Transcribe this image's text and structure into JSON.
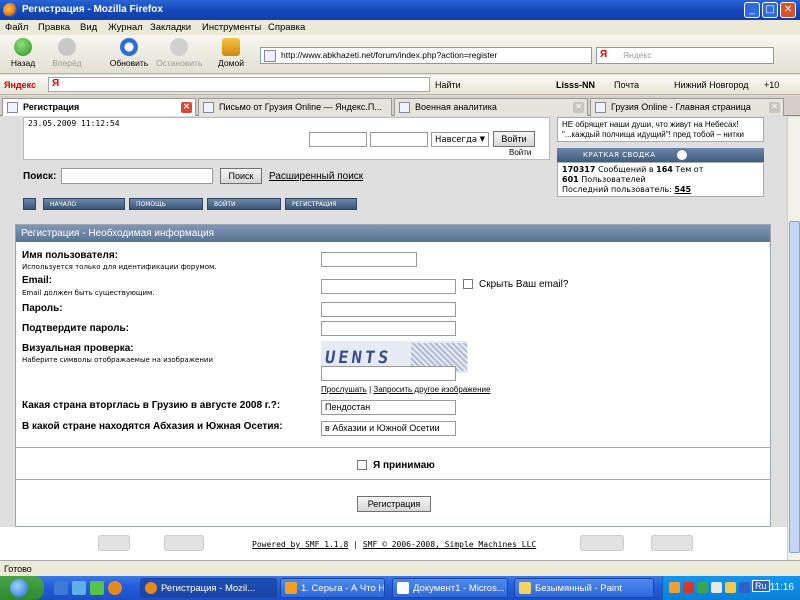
{
  "window": {
    "title": "Регистрация - Mozilla Firefox"
  },
  "menu": [
    "Файл",
    "Правка",
    "Вид",
    "Журнал",
    "Закладки",
    "Инструменты",
    "Справка"
  ],
  "nav": {
    "back": "Назад",
    "forward": "Вперёд",
    "reload": "Обновить",
    "stop": "Остановить",
    "home": "Домой",
    "url": "http://www.abkhazeti.net/forum/index.php?action=register",
    "search_placeholder": "Яндекс",
    "search_logo": "Я"
  },
  "yandex_bar": {
    "logo": "Яндекс",
    "ya": "Я",
    "find": "Найти",
    "user": "Lisss-NN",
    "mail": "Почта",
    "city": "Нижний Новгород",
    "temp": "+10"
  },
  "tabs": [
    {
      "label": "Регистрация",
      "active": true
    },
    {
      "label": "Письмо от Грузия Online — Яндекс.П...",
      "active": false
    },
    {
      "label": "Военная аналитика",
      "active": false
    },
    {
      "label": "Грузия Online - Главная страница",
      "active": false
    }
  ],
  "page": {
    "date": "23.05.2009 11:12:54",
    "remember_option": "Навсегда",
    "login_button": "Войти",
    "login_link": "Войти",
    "right_text_1": "НЕ обрящет наши души, что живут на Небесах!",
    "right_text_2": "\"...каждый полчища идущий\"! пред тобой – нитки Укиста",
    "summary_title": "КРАТКАЯ СВОДКА",
    "summary_messages": "170317",
    "summary_messages_label": "Сообщений в",
    "summary_topics": "164",
    "summary_topics_label": "Тем от",
    "summary_users": "601",
    "summary_users_label": "Пользователей",
    "summary_last_label": "Последний пользователь:",
    "summary_last_user": "545",
    "search_label": "Поиск:",
    "search_button": "Поиск",
    "advanced_search": "Расширенный поиск",
    "forum_buttons": [
      "НАЧАЛО",
      "ПОМОЩЬ",
      "ВОЙТИ",
      "РЕГИСТРАЦИЯ"
    ],
    "form_header": "Регистрация - Необходимая информация",
    "username_label": "Имя пользователя:",
    "username_hint": "Используется только для идентификации форумом.",
    "email_label": "Email:",
    "email_hint": "Email должен быть существующим.",
    "hide_email": "Скрыть Ваш email?",
    "password_label": "Пароль:",
    "confirm_label": "Подтвердите пароль:",
    "visual_label": "Визуальная проверка:",
    "visual_hint": "Наберите символы отображаемые на изображении",
    "captcha_text": "UENTS",
    "listen_link": "Прослушать",
    "other_image_link": "Запросить другое изображение",
    "q1_label": "Какая страна вторглась в Грузию в августе 2008 г.?:",
    "q1_value": "Пендостан",
    "q2_label": "В какой стране находятся Абхазия и Южная Осетия:",
    "q2_value": "в Абхазии и Южной Осетии",
    "accept_label": "Я принимаю",
    "register_button": "Регистрация",
    "footer_powered": "Powered by SMF 1.1.8",
    "footer_sep": "|",
    "footer_copy": "SMF © 2006-2008, Simple Machines LLC"
  },
  "status": "Готово",
  "taskbar": {
    "tasks": [
      {
        "label": "Регистрация - Mozil...",
        "active": true
      },
      {
        "label": "1. Серьга - А Что Н...",
        "active": false
      },
      {
        "label": "Документ1 - Micros...",
        "active": false
      },
      {
        "label": "Безымянный - Paint",
        "active": false
      }
    ],
    "lang": "Ru",
    "clock": "11:16"
  }
}
